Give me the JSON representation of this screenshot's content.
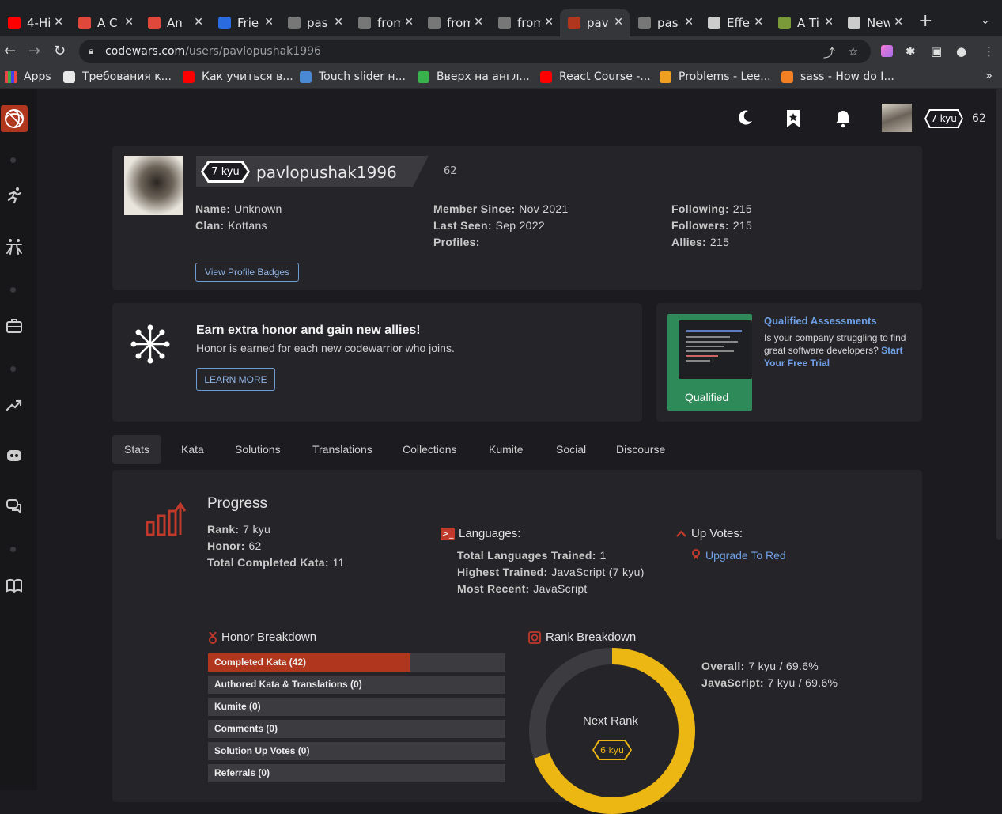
{
  "browser": {
    "tabs": [
      {
        "title": "4-Hi",
        "color": "#ff0000"
      },
      {
        "title": "A C",
        "color": "#e0483b"
      },
      {
        "title": "An",
        "color": "#e0483b"
      },
      {
        "title": "Frie",
        "color": "#2a6be0"
      },
      {
        "title": "pas",
        "color": "#777777"
      },
      {
        "title": "from",
        "color": "#777777"
      },
      {
        "title": "from",
        "color": "#777777"
      },
      {
        "title": "from",
        "color": "#777777"
      },
      {
        "title": "pav",
        "color": "#b1361e"
      },
      {
        "title": "pas",
        "color": "#777777"
      },
      {
        "title": "Effe",
        "color": "#cccccc"
      },
      {
        "title": "A Ti",
        "color": "#7a9a3a"
      },
      {
        "title": "New",
        "color": "#cccccc"
      }
    ],
    "url_domain": "codewars.com",
    "url_path": "/users/pavlopushak1996",
    "bookmarks": [
      {
        "label": "Apps",
        "color": "#c44"
      },
      {
        "label": "Требования к...",
        "color": "#e8e8e8"
      },
      {
        "label": "Как учиться в...",
        "color": "#ff0000"
      },
      {
        "label": "Touch slider н...",
        "color": "#4a8ad4"
      },
      {
        "label": "Вверх на англ...",
        "color": "#37b24d"
      },
      {
        "label": "React Course -...",
        "color": "#ff0000"
      },
      {
        "label": "Problems - Lee...",
        "color": "#f0a020"
      },
      {
        "label": "sass - How do I...",
        "color": "#f48024"
      }
    ],
    "bookmarks_more": "»"
  },
  "topnav": {
    "rank": "7 kyu",
    "honor": "62"
  },
  "profile": {
    "rank": "7 kyu",
    "username": "pavlopushak1996",
    "honor": "62",
    "name_label": "Name:",
    "name_value": "Unknown",
    "clan_label": "Clan:",
    "clan_value": "Kottans",
    "member_label": "Member Since:",
    "member_value": "Nov 2021",
    "seen_label": "Last Seen:",
    "seen_value": "Sep 2022",
    "profiles_label": "Profiles:",
    "following_label": "Following:",
    "following_value": "215",
    "followers_label": "Followers:",
    "followers_value": "215",
    "allies_label": "Allies:",
    "allies_value": "215",
    "badges_button": "View Profile Badges"
  },
  "promo": {
    "title": "Earn extra honor and gain new allies!",
    "text": "Honor is earned for each new codewarrior who joins.",
    "button": "LEARN MORE"
  },
  "ad": {
    "image_label": "Qualified",
    "title": "Qualified Assessments",
    "text": "Is your company struggling to find great software developers?",
    "link": "Start Your Free Trial"
  },
  "profile_tabs": [
    "Stats",
    "Kata",
    "Solutions",
    "Translations",
    "Collections",
    "Kumite",
    "Social",
    "Discourse"
  ],
  "progress": {
    "title": "Progress",
    "rank_label": "Rank:",
    "rank_value": "7 kyu",
    "honor_label": "Honor:",
    "honor_value": "62",
    "kata_label": "Total Completed Kata:",
    "kata_value": "11"
  },
  "languages": {
    "title": "Languages:",
    "trained_label": "Total Languages Trained:",
    "trained_value": "1",
    "highest_label": "Highest Trained:",
    "highest_value": "JavaScript (7 kyu)",
    "recent_label": "Most Recent:",
    "recent_value": "JavaScript"
  },
  "upvotes": {
    "title": "Up Votes:",
    "link": "Upgrade To Red"
  },
  "honor_breakdown": {
    "title": "Honor Breakdown",
    "rows": [
      {
        "label": "Completed Kata (42)",
        "fill": 0.68
      },
      {
        "label": "Authored Kata & Translations (0)",
        "fill": 0
      },
      {
        "label": "Kumite (0)",
        "fill": 0
      },
      {
        "label": "Comments (0)",
        "fill": 0
      },
      {
        "label": "Solution Up Votes (0)",
        "fill": 0
      },
      {
        "label": "Referrals (0)",
        "fill": 0
      }
    ]
  },
  "rank_breakdown": {
    "title": "Rank Breakdown",
    "overall_label": "Overall:",
    "overall_value": "7 kyu / 69.6%",
    "js_label": "JavaScript:",
    "js_value": "7 kyu / 69.6%",
    "progress_percent": 69.6,
    "next_rank_label": "Next Rank",
    "next_rank": "6 kyu"
  },
  "colors": {
    "brand": "#b1361e",
    "accent_yellow": "#ecb613",
    "link": "#6fa0e6"
  }
}
